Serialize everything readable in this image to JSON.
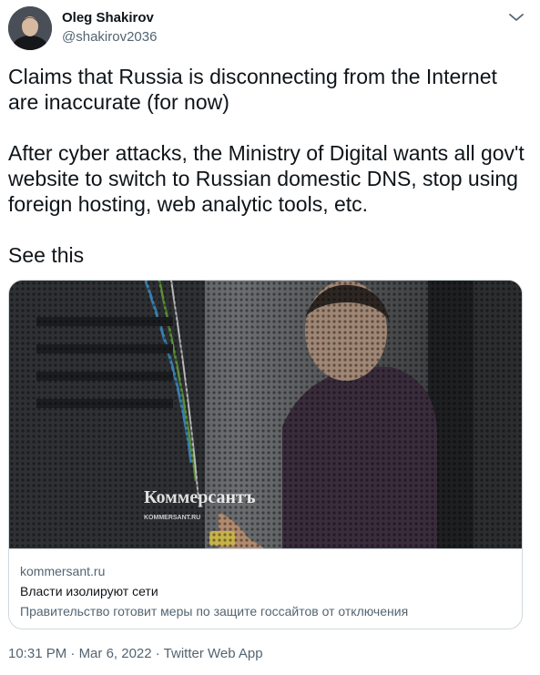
{
  "author": {
    "name": "Oleg Shakirov",
    "handle": "@shakirov2036"
  },
  "tweet": {
    "line1": "Claims that Russia is disconnecting from the Internet are inaccurate (for now)",
    "line2": "After cyber attacks, the Ministry of Digital wants all gov't website to switch to Russian domestic DNS, stop using foreign hosting, web analytic tools, etc.",
    "line3": "See this"
  },
  "card": {
    "watermark_logo": "Коммерсантъ",
    "watermark_site": "KOMMERSANT.RU",
    "domain": "kommersant.ru",
    "title": "Власти изолируют сети",
    "description": "Правительство готовит меры по защите госсайтов от отключения"
  },
  "meta": {
    "time": "10:31 PM",
    "separator": " · ",
    "date": "Mar 6, 2022",
    "client": "Twitter Web App"
  },
  "icons": {
    "more": "chevron-down-icon"
  }
}
